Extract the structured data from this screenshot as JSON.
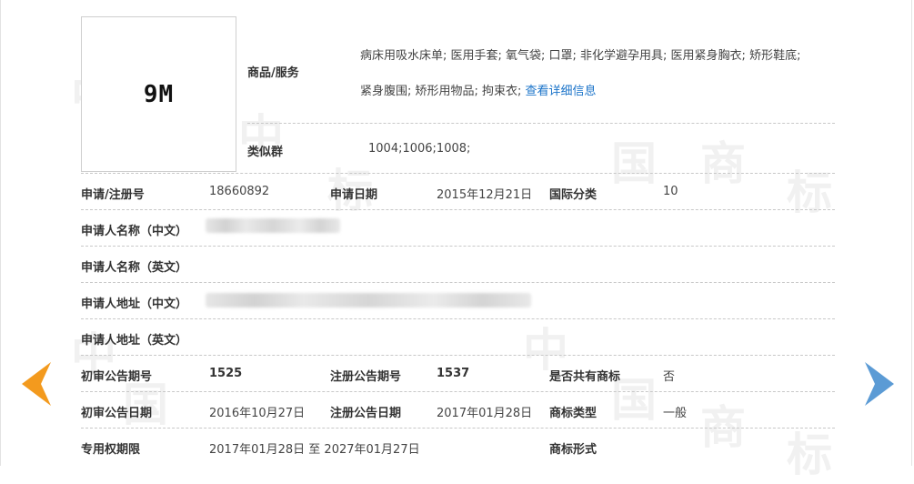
{
  "logo": {
    "text": "9M"
  },
  "goods": {
    "label": "商品/服务",
    "line1": "病床用吸水床单; 医用手套; 氧气袋; 口罩; 非化学避孕用具; 医用紧身胸衣; 矫形鞋底;",
    "line2": "紧身腹围; 矫形用物品; 拘束衣;",
    "detail_link": "查看详细信息"
  },
  "similar_group": {
    "label": "类似群",
    "value": "1004;1006;1008;"
  },
  "fields": {
    "reg_no_label": "申请/注册号",
    "reg_no": "18660892",
    "apply_date_label": "申请日期",
    "apply_date": "2015年12月21日",
    "intl_class_label": "国际分类",
    "intl_class": "10",
    "applicant_cn_label": "申请人名称（中文）",
    "applicant_en_label": "申请人名称（英文）",
    "address_cn_label": "申请人地址（中文）",
    "address_en_label": "申请人地址（英文）",
    "prelim_no_label": "初审公告期号",
    "prelim_no": "1525",
    "reg_notice_no_label": "注册公告期号",
    "reg_notice_no": "1537",
    "shared_label": "是否共有商标",
    "shared": "否",
    "prelim_date_label": "初审公告日期",
    "prelim_date": "2016年10月27日",
    "reg_notice_date_label": "注册公告日期",
    "reg_notice_date": "2017年01月28日",
    "tm_type_label": "商标类型",
    "tm_type": "一般",
    "exclusive_label": "专用权期限",
    "exclusive": "2017年01月28日 至 2027年01月27日",
    "tm_form_label": "商标形式"
  },
  "watermark": "中国商标",
  "colors": {
    "prev_arrow": "#f39a1e",
    "next_arrow": "#5b9bd5",
    "link": "#1a73c9"
  }
}
